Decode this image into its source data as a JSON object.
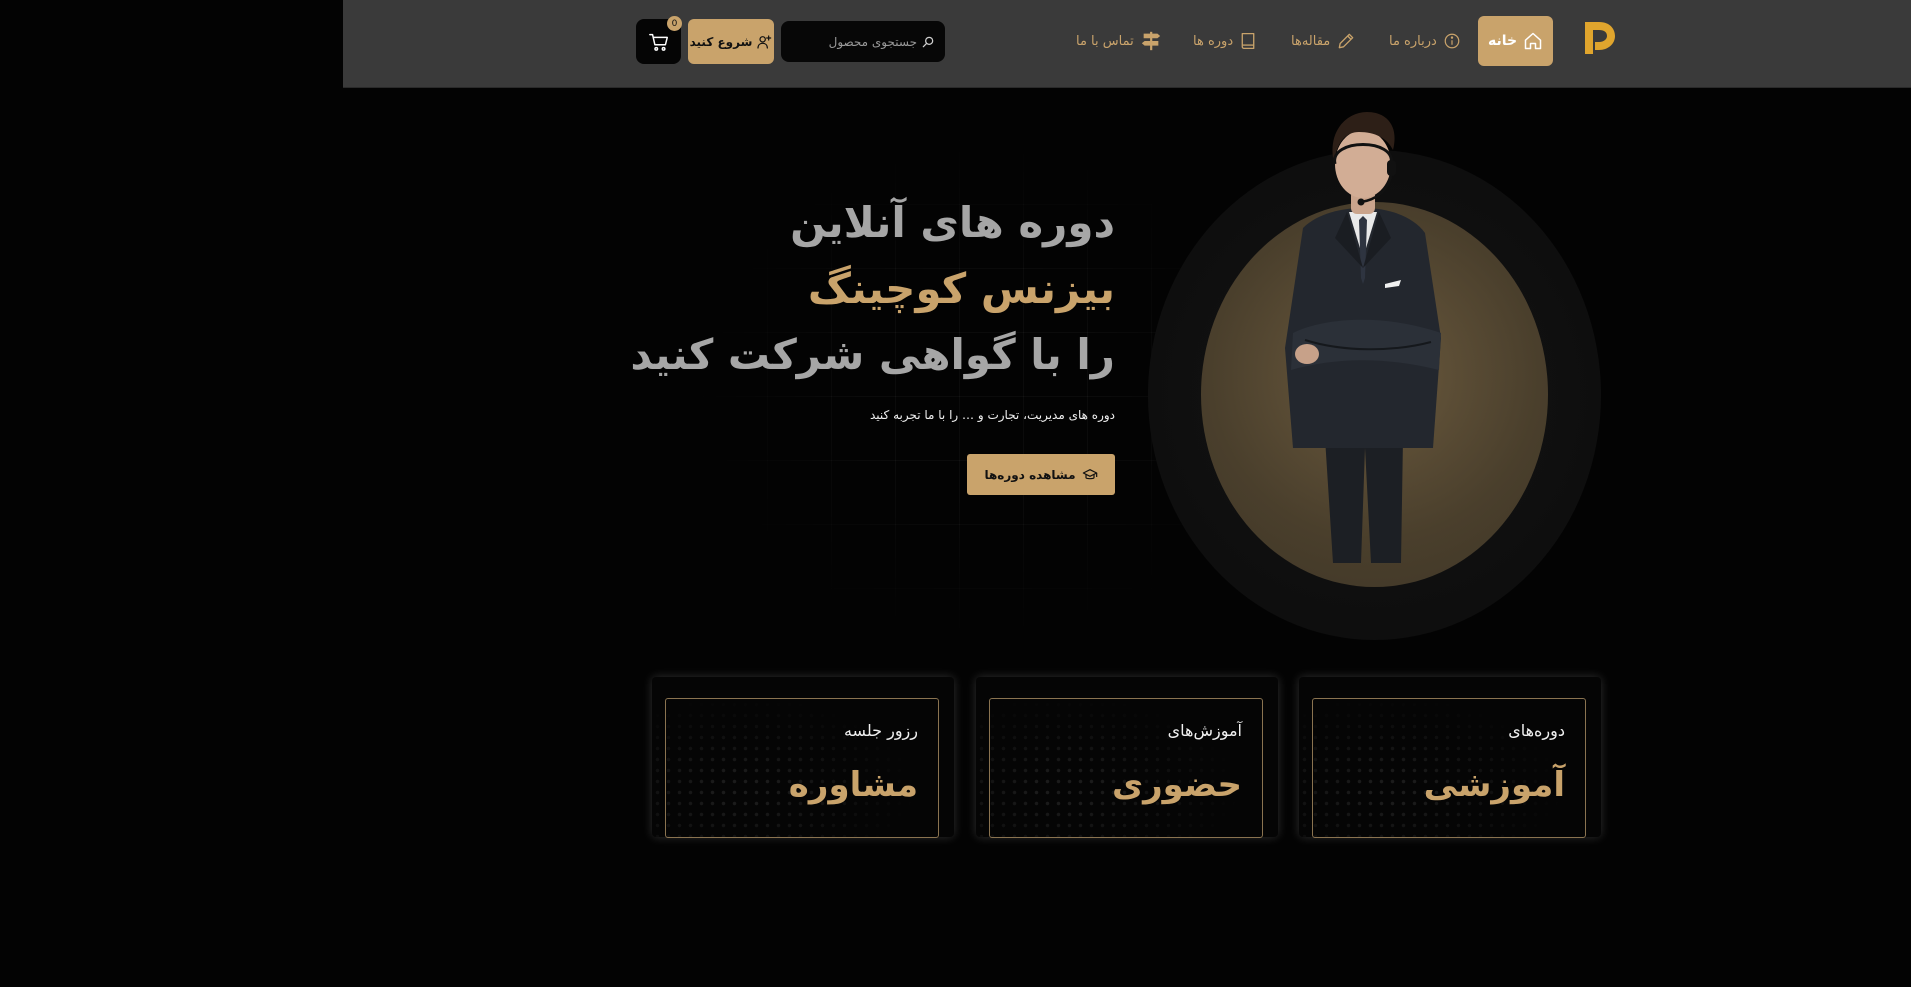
{
  "header": {
    "nav": {
      "home": "خانه",
      "about": "درباره ما",
      "articles": "مقاله‌ها",
      "courses": "دوره ها",
      "contact": "تماس با ما"
    },
    "search": {
      "placeholder": "جستجوی محصول"
    },
    "login_label": "شروع کنید",
    "cart_count": "0"
  },
  "hero": {
    "line1": "دوره های آنلاین",
    "line2": "بیزنس کوچینگ",
    "line3": "را با گواهی شرکت کنید",
    "subtitle": "دوره های مدیریت، تجارت و … را با ما تجربه کنید",
    "cta_label": "مشاهده دوره‌ها"
  },
  "cards": [
    {
      "small": "دوره‌های",
      "big": "آموزشی"
    },
    {
      "small": "آموزش‌های",
      "big": "حضوری"
    },
    {
      "small": "رزور جلسه",
      "big": "مشاوره"
    }
  ],
  "colors": {
    "accent": "#c9a36b",
    "header_bg": "#3a3a3a",
    "page_bg": "#030303"
  },
  "icons": {
    "logo": "brand-logo-icon",
    "home": "home-icon",
    "about": "info-icon",
    "articles": "pencil-icon",
    "courses": "book-icon",
    "contact": "signpost-icon",
    "search": "search-icon",
    "login": "user-plus-icon",
    "cart": "cart-icon",
    "cta": "graduation-cap-icon"
  }
}
